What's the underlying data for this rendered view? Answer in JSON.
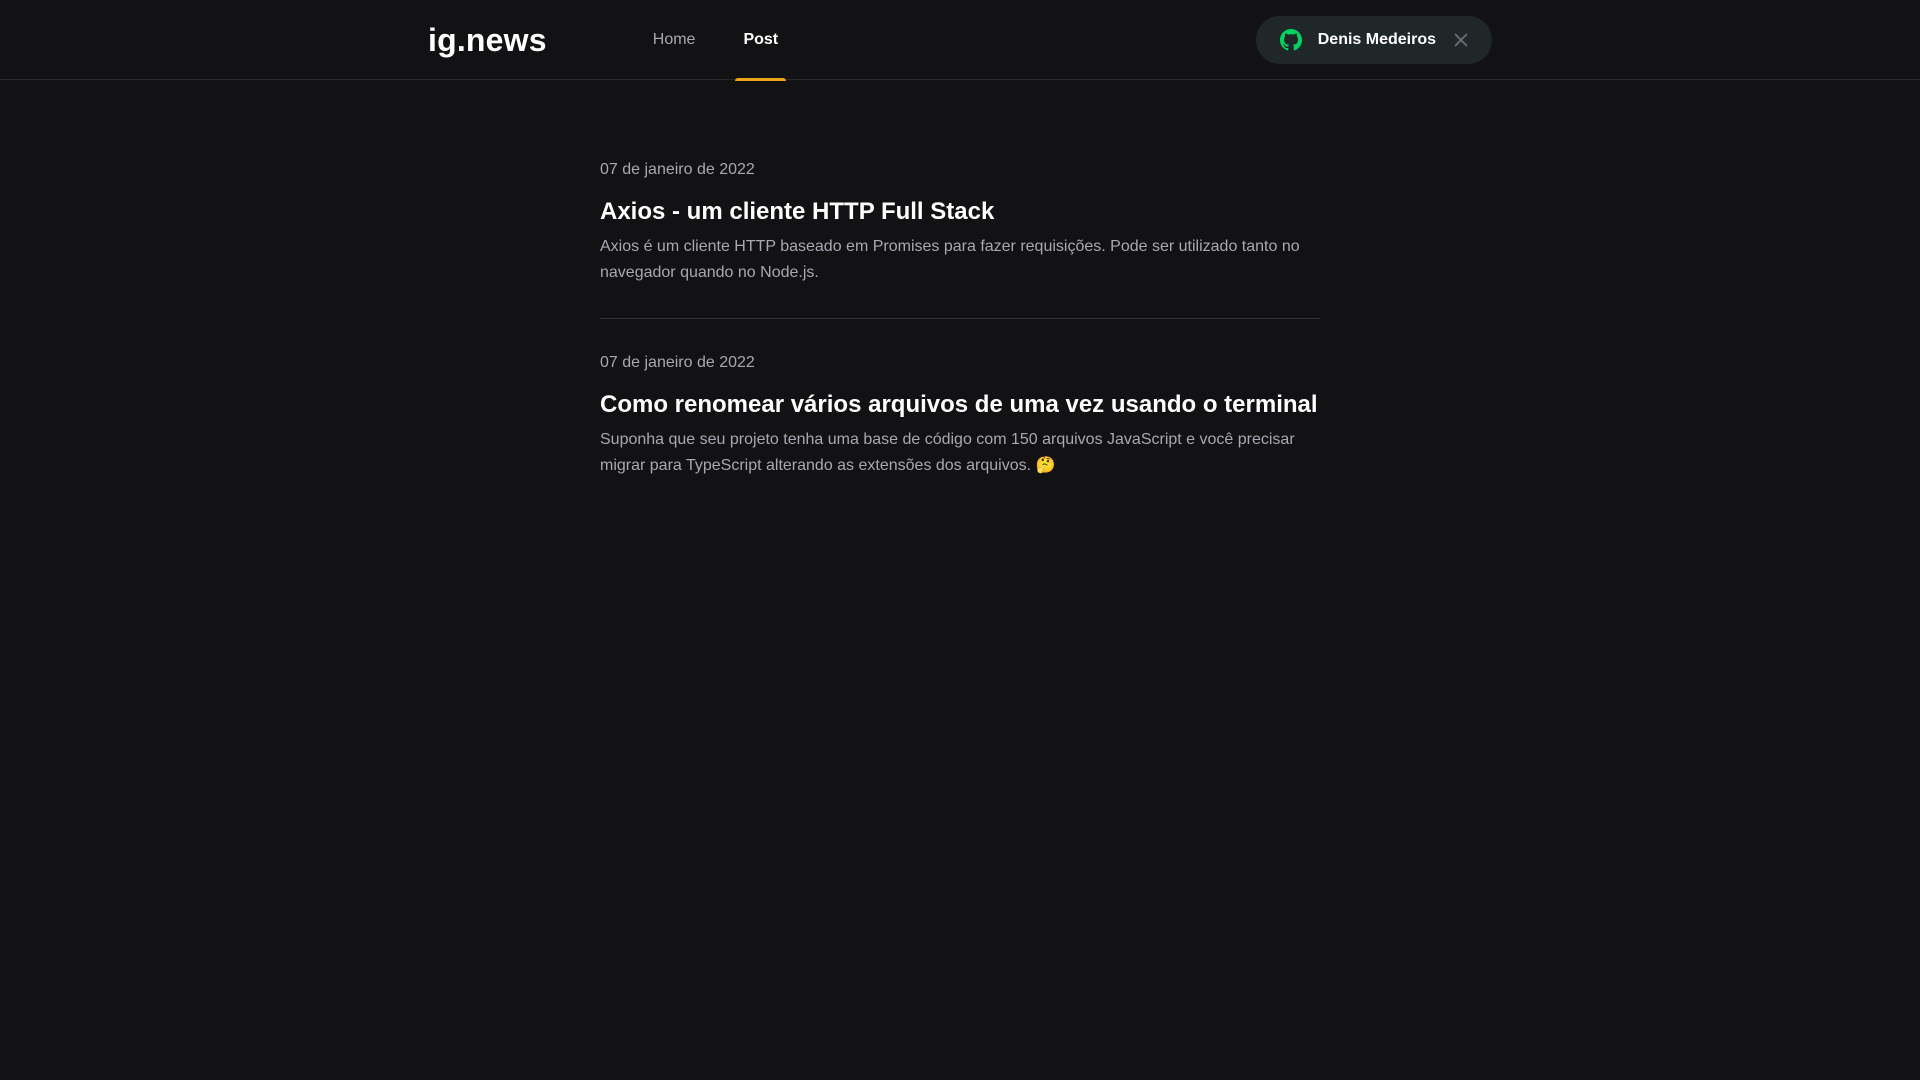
{
  "header": {
    "logo": "ig.news",
    "nav": [
      {
        "label": "Home",
        "active": false
      },
      {
        "label": "Post",
        "active": true
      }
    ],
    "user": {
      "name": "Denis Medeiros",
      "icon": "github-icon",
      "close_icon": "close-icon"
    }
  },
  "posts": [
    {
      "date": "07 de janeiro de 2022",
      "title": "Axios - um cliente HTTP Full Stack",
      "excerpt": "Axios é um cliente HTTP baseado em Promises para fazer requisições. Pode ser utilizado tanto no navegador quando no Node.js."
    },
    {
      "date": "07 de janeiro de 2022",
      "title": "Como renomear vários arquivos de uma vez usando o terminal",
      "excerpt": "Suponha que seu projeto tenha uma base de código com 150 arquivos JavaScript e você precisar migrar para TypeScript alterando as extensões dos arquivos. 🤔"
    }
  ],
  "colors": {
    "background": "#121214",
    "accent": "#eba417",
    "github": "#04d361",
    "user_button_bg": "#1f2729"
  }
}
